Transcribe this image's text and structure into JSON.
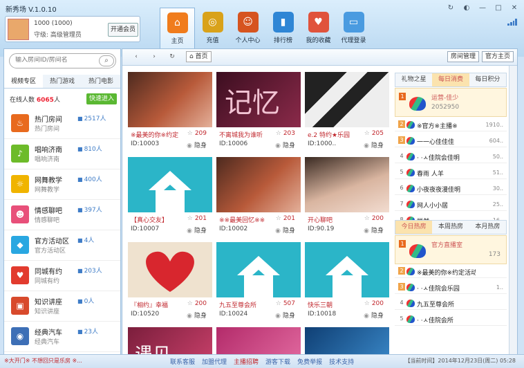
{
  "app": {
    "title": "新秀场 V.1.0.10"
  },
  "window_buttons": [
    "refresh-icon",
    "skin-icon",
    "minimize-icon",
    "maximize-icon",
    "close-icon"
  ],
  "user": {
    "name": "1000 (1000)",
    "level": "守级: 高级管理员",
    "open_vip": "开通会员"
  },
  "nav": [
    {
      "label": "主页",
      "icon": "home-icon",
      "color": "#f07c1c",
      "active": true
    },
    {
      "label": "充值",
      "icon": "coins-icon",
      "color": "#d9a21a"
    },
    {
      "label": "个人中心",
      "icon": "user-center-icon",
      "color": "#d6541f"
    },
    {
      "label": "排行榜",
      "icon": "bar-chart-icon",
      "color": "#2f86d5"
    },
    {
      "label": "我的收藏",
      "icon": "favorites-icon",
      "color": "#e0533c"
    },
    {
      "label": "代理登录",
      "icon": "monitor-icon",
      "color": "#4a9be0"
    }
  ],
  "sidebar": {
    "search_placeholder": "输入房间ID/房间名",
    "tabs": [
      "视频专区",
      "热门游戏",
      "热门电影"
    ],
    "online_label": "在线人数",
    "online_count": "6065",
    "online_unit": "人",
    "quick_join": "快速进入",
    "rooms": [
      {
        "name": "热门房间",
        "sub": "热门房间",
        "count": "2517人",
        "color": "#e86a1e",
        "icon": "fire-icon"
      },
      {
        "name": "唱响济南",
        "sub": "唱响济南",
        "count": "810人",
        "color": "#6dbb2a",
        "icon": "music-icon"
      },
      {
        "name": "网舞教学",
        "sub": "网舞教学",
        "count": "400人",
        "color": "#f0b400",
        "icon": "dance-icon"
      },
      {
        "name": "情感聊吧",
        "sub": "情感聊吧",
        "count": "397人",
        "color": "#e8507a",
        "icon": "chat-icon"
      },
      {
        "name": "官方活动区",
        "sub": "官方活动区",
        "count": "4人",
        "color": "#29a7e1",
        "icon": "diamond-icon"
      },
      {
        "name": "同城有约",
        "sub": "同城有约",
        "count": "203人",
        "color": "#e23b2e",
        "icon": "heart-group-icon"
      },
      {
        "name": "知识讲座",
        "sub": "知识讲座",
        "count": "0人",
        "color": "#d84a2c",
        "icon": "tv-icon"
      },
      {
        "name": "经典汽车",
        "sub": "经典汽车",
        "count": "23人",
        "color": "#3d6fb6",
        "icon": "car-icon"
      }
    ]
  },
  "toolbar": {
    "home": "首页",
    "my_room": "房间管理",
    "official": "官方主页"
  },
  "cards": [
    {
      "name": "※最美的你※约定",
      "fav": "209",
      "id": "ID:10003",
      "status": "隐身",
      "img": "photo-man"
    },
    {
      "name": "不离城我为谁听",
      "fav": "203",
      "id": "ID:10006",
      "status": "隐身",
      "img": "memory"
    },
    {
      "name": "e.2 特约★乐园",
      "fav": "205",
      "id": "ID:1000..",
      "status": "隐身",
      "img": "piano"
    },
    {
      "name": "【真心交友】",
      "fav": "201",
      "id": "ID:10007",
      "status": "隐身",
      "img": "house"
    },
    {
      "name": "※※最美回忆※※",
      "fav": "201",
      "id": "ID:10002",
      "status": "隐身",
      "img": "photo-man"
    },
    {
      "name": "开心聊吧",
      "fav": "200",
      "id": "ID:90.19",
      "status": "隐身",
      "img": "girl"
    },
    {
      "name": "『相约』幸福",
      "fav": "200",
      "id": "ID:10520",
      "status": "隐身",
      "img": "heart"
    },
    {
      "name": "九五至尊会所",
      "fav": "507",
      "id": "ID:10024",
      "status": "隐身",
      "img": "house"
    },
    {
      "name": "快乐三朝",
      "fav": "200",
      "id": "ID:10018",
      "status": "隐身",
      "img": "house"
    },
    {
      "name": "遇见",
      "fav": "",
      "id": "",
      "status": "",
      "img": "meet"
    },
    {
      "name": "",
      "fav": "",
      "id": "",
      "status": "",
      "img": "pink"
    },
    {
      "name": "",
      "fav": "",
      "id": "",
      "status": "",
      "img": "blue"
    }
  ],
  "panel1": {
    "tabs": [
      "礼物之星",
      "每日消费",
      "每日积分"
    ],
    "top": {
      "name": "运营-佳少",
      "value": "2052950"
    },
    "rows": [
      {
        "rank": "2",
        "name": "※官方※主播※",
        "value": "1910.."
      },
      {
        "rank": "3",
        "name": "一一心佳佳佳",
        "value": "604.."
      },
      {
        "rank": "4",
        "name": "· ·ㅅ佳院会佳明",
        "value": "50.."
      },
      {
        "rank": "5",
        "name": "春雨 人羊",
        "value": "51.."
      },
      {
        "rank": "6",
        "name": "小夜夜夜漫佳明",
        "value": "30.."
      },
      {
        "rank": "7",
        "name": "网人小小居",
        "value": "25.."
      },
      {
        "rank": "8",
        "name": "悦然",
        "value": "16.."
      }
    ]
  },
  "panel2": {
    "tabs": [
      "今日热房",
      "本周热房",
      "本月热房"
    ],
    "top": {
      "name": "官方直播室",
      "value": "173"
    },
    "rows": [
      {
        "rank": "2",
        "name": "※最美的你※约定活动※",
        "value": ""
      },
      {
        "rank": "3",
        "name": "· ·ㅅ佳院会乐园",
        "value": "1.."
      },
      {
        "rank": "4",
        "name": "九五至尊会所",
        "value": ""
      },
      {
        "rank": "5",
        "name": "· ·ㅅ佳院会所",
        "value": ""
      }
    ]
  },
  "footer": {
    "left": "※大开门※ 不想回只是乐房 ※...",
    "links": [
      "联系客服",
      "加盟代理",
      "主播招聘",
      "游客下载",
      "免费举报",
      "技术支持"
    ],
    "date": "【当前时间】2014年12月23日(周二) 05:28"
  }
}
